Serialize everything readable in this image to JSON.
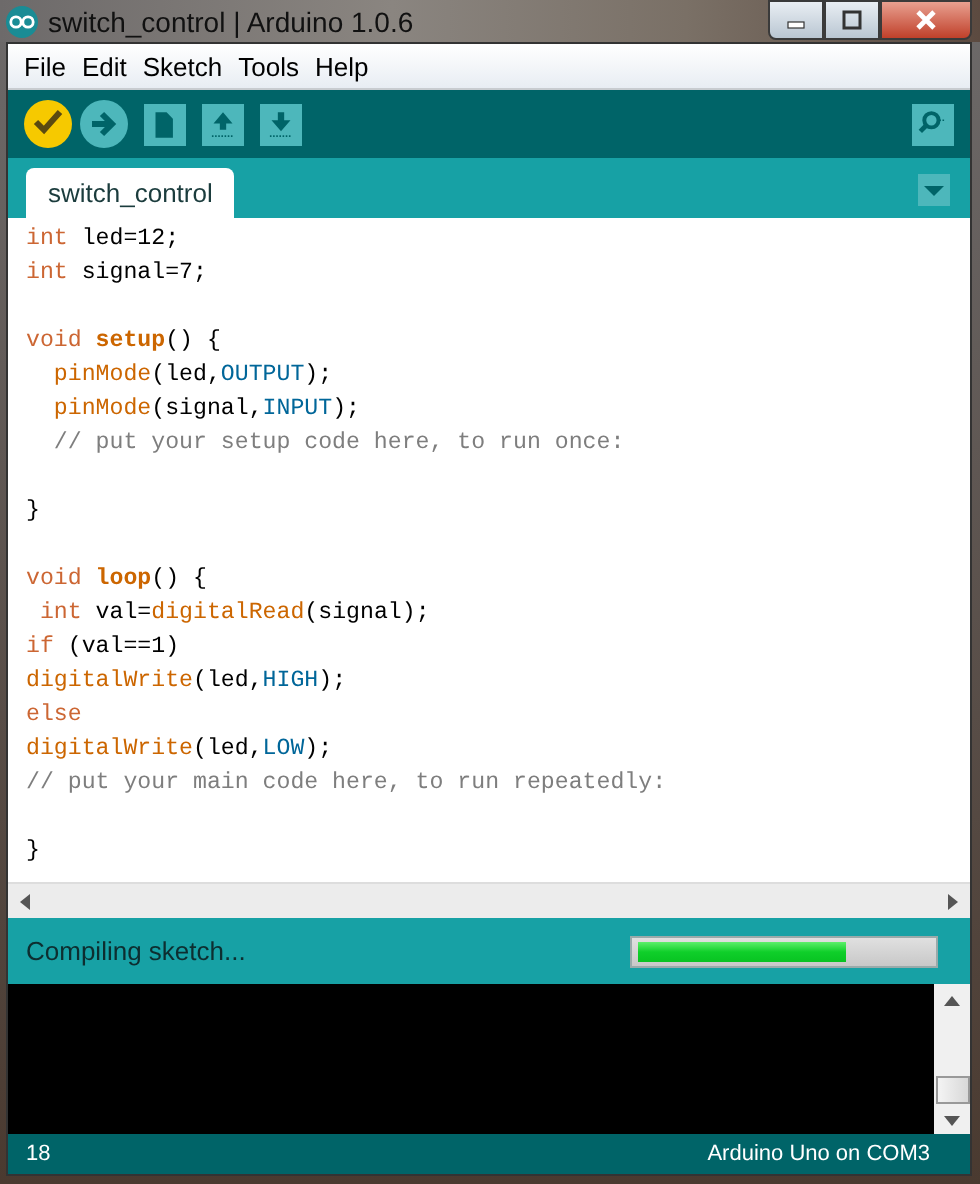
{
  "window": {
    "title": "switch_control | Arduino 1.0.6"
  },
  "menu": [
    "File",
    "Edit",
    "Sketch",
    "Tools",
    "Help"
  ],
  "toolbar": [
    {
      "kind": "verify",
      "active": true
    },
    {
      "kind": "upload",
      "active": false
    },
    {
      "kind": "new",
      "active": false
    },
    {
      "kind": "open",
      "active": false
    },
    {
      "kind": "save",
      "active": false
    }
  ],
  "tabs": [
    {
      "label": "switch_control",
      "selected": true
    }
  ],
  "code": [
    {
      "kind": "code",
      "tokens": [
        {
          "kind": "keyword",
          "s": "int"
        },
        {
          "kind": "plain",
          "s": " led=12;"
        }
      ]
    },
    {
      "kind": "code",
      "tokens": [
        {
          "kind": "keyword",
          "s": "int"
        },
        {
          "kind": "plain",
          "s": " signal=7;"
        }
      ]
    },
    {
      "kind": "blank"
    },
    {
      "kind": "code",
      "tokens": [
        {
          "kind": "keyword",
          "s": "void "
        },
        {
          "kind": "function",
          "s": "setup"
        },
        {
          "kind": "plain",
          "s": "() {"
        }
      ]
    },
    {
      "kind": "code",
      "tokens": [
        {
          "kind": "builtin",
          "s": "  pinMode"
        },
        {
          "kind": "plain",
          "s": "(led,"
        },
        {
          "kind": "constant",
          "s": "OUTPUT"
        },
        {
          "kind": "plain",
          "s": ");"
        }
      ]
    },
    {
      "kind": "code",
      "tokens": [
        {
          "kind": "builtin",
          "s": "  pinMode"
        },
        {
          "kind": "plain",
          "s": "(signal,"
        },
        {
          "kind": "constant",
          "s": "INPUT"
        },
        {
          "kind": "plain",
          "s": ");"
        }
      ]
    },
    {
      "kind": "code",
      "tokens": [
        {
          "kind": "comment",
          "s": "  // put your setup code here, to run once:"
        }
      ]
    },
    {
      "kind": "blank"
    },
    {
      "kind": "code",
      "tokens": [
        {
          "kind": "plain",
          "s": "}"
        }
      ]
    },
    {
      "kind": "blank"
    },
    {
      "kind": "code",
      "tokens": [
        {
          "kind": "keyword",
          "s": "void "
        },
        {
          "kind": "function",
          "s": "loop"
        },
        {
          "kind": "plain",
          "s": "() {"
        }
      ]
    },
    {
      "kind": "code",
      "tokens": [
        {
          "kind": "keyword",
          "s": " int"
        },
        {
          "kind": "plain",
          "s": " val="
        },
        {
          "kind": "builtin",
          "s": "digitalRead"
        },
        {
          "kind": "plain",
          "s": "(signal);"
        }
      ]
    },
    {
      "kind": "code",
      "tokens": [
        {
          "kind": "keyword",
          "s": "if"
        },
        {
          "kind": "plain",
          "s": " (val==1)"
        }
      ]
    },
    {
      "kind": "code",
      "tokens": [
        {
          "kind": "builtin",
          "s": "digitalWrite"
        },
        {
          "kind": "plain",
          "s": "(led,"
        },
        {
          "kind": "constant",
          "s": "HIGH"
        },
        {
          "kind": "plain",
          "s": ");"
        }
      ]
    },
    {
      "kind": "code",
      "tokens": [
        {
          "kind": "keyword",
          "s": "else"
        }
      ]
    },
    {
      "kind": "code",
      "tokens": [
        {
          "kind": "builtin",
          "s": "digitalWrite"
        },
        {
          "kind": "plain",
          "s": "(led,"
        },
        {
          "kind": "constant",
          "s": "LOW"
        },
        {
          "kind": "plain",
          "s": ");"
        }
      ]
    },
    {
      "kind": "code",
      "tokens": [
        {
          "kind": "comment",
          "s": "// put your main code here, to run repeatedly:"
        }
      ]
    },
    {
      "kind": "blank"
    },
    {
      "kind": "code",
      "tokens": [
        {
          "kind": "plain",
          "s": "}"
        }
      ]
    }
  ],
  "status": {
    "message": "Compiling sketch...",
    "level": 0.71
  },
  "status_bar": {
    "line": "18",
    "board": "Arduino Uno on COM3"
  }
}
